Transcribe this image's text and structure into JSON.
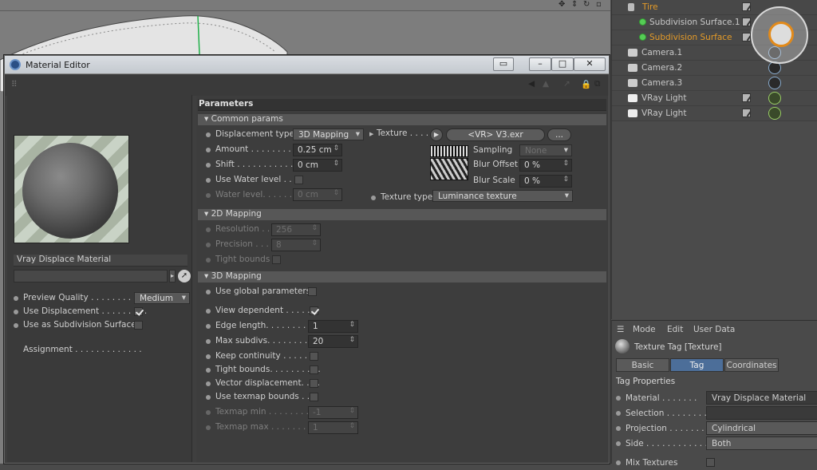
{
  "objects": [
    {
      "name": "Tire",
      "type": "null",
      "selected": true,
      "partial": true
    },
    {
      "name": "Subdivision Surface.1",
      "type": "subdivision",
      "selected": false
    },
    {
      "name": "Subdivision Surface",
      "type": "subdivision",
      "selected": true
    },
    {
      "name": "Camera.1",
      "type": "camera",
      "selected": false
    },
    {
      "name": "Camera.2",
      "type": "camera",
      "selected": false
    },
    {
      "name": "Camera.3",
      "type": "camera",
      "selected": false
    },
    {
      "name": "VRay Light",
      "type": "light",
      "selected": false
    },
    {
      "name": "VRay Light",
      "type": "light",
      "selected": false
    }
  ],
  "attributes": {
    "menu": [
      "Mode",
      "Edit",
      "User Data"
    ],
    "header": "Texture Tag [Texture]",
    "tabs": [
      "Basic",
      "Tag",
      "Coordinates"
    ],
    "active_tab": "Tag",
    "section": "Tag Properties",
    "props": [
      {
        "label": "Material . . . . . . .",
        "value": "Vray Displace Material"
      },
      {
        "label": "Selection . . . . . . . .",
        "value": ""
      },
      {
        "label": "Projection . . . . . . .",
        "value": "Cylindrical"
      },
      {
        "label": "Side . . . . . . . . . . . . .",
        "value": "Both"
      },
      {
        "label": "Mix Textures",
        "value": ""
      }
    ]
  },
  "material_editor": {
    "title": "Material Editor",
    "buttons": {
      "minimize": "–",
      "maximize": "□",
      "close": "✕"
    },
    "material_name": "Vray Displace Material",
    "left_rows": [
      {
        "label": "Preview Quality . . . . . . . . . . .",
        "control": "dropdown",
        "value": "Medium"
      },
      {
        "label": "Use Displacement . . . . . . . . .",
        "control": "check",
        "value": true
      },
      {
        "label": "Use as Subdivision Surface",
        "control": "check",
        "value": false
      }
    ],
    "assignment_label": "Assignment . . . . . . . . . . . . .",
    "parameters_title": "Parameters",
    "sections": {
      "common": "Common params",
      "mapping2d": "2D Mapping",
      "mapping3d": "3D Mapping"
    },
    "common": {
      "displacement_type_label": "Displacement type",
      "displacement_type": "3D Mapping",
      "amount_label": "Amount . . . . . . . . .",
      "amount": "0.25 cm",
      "shift_label": "Shift . . . . . . . . . . . . .",
      "shift": "0 cm",
      "water_label": "Use Water level . .",
      "waterlevel_label": "Water level. . . . . . . .",
      "waterlevel": "0 cm",
      "texture_label": "Texture . . . . . .",
      "texture_value": "<VR> V3.exr",
      "more": "...",
      "sampling_label": "Sampling",
      "sampling": "None",
      "blur_offset_label": "Blur Offset",
      "blur_offset": "0 %",
      "blur_scale_label": "Blur Scale",
      "blur_scale": "0 %",
      "texture_type_label": "Texture type",
      "texture_type": "Luminance texture"
    },
    "mapping2d": {
      "resolution_label": "Resolution . . .",
      "resolution": "256",
      "precision_label": "Precision . . . . .",
      "precision": "8",
      "tight_label": "Tight bounds"
    },
    "mapping3d": {
      "rows": [
        {
          "label": "Use global parameters",
          "control": "check",
          "value": false,
          "disabled": false
        },
        {
          "label": "View dependent . . . . . .",
          "control": "check",
          "value": true,
          "disabled": false
        },
        {
          "label": "Edge length. . . . . . . . . .",
          "control": "num",
          "value": "1",
          "disabled": false
        },
        {
          "label": "Max subdivs. . . . . . . . . .",
          "control": "num",
          "value": "20",
          "disabled": false
        },
        {
          "label": "Keep continuity . . . . . .",
          "control": "check",
          "value": false,
          "disabled": false
        },
        {
          "label": "Tight bounds. . . . . . . . . .",
          "control": "check",
          "value": false,
          "disabled": false
        },
        {
          "label": "Vector displacement. . . .",
          "control": "check",
          "value": false,
          "disabled": false
        },
        {
          "label": "Use texmap bounds . . .",
          "control": "check",
          "value": false,
          "disabled": false
        },
        {
          "label": "Texmap min . . . . . . . . .",
          "control": "num",
          "value": "-1",
          "disabled": true
        },
        {
          "label": "Texmap max . . . . . . . . .",
          "control": "num",
          "value": "1",
          "disabled": true
        }
      ]
    }
  }
}
